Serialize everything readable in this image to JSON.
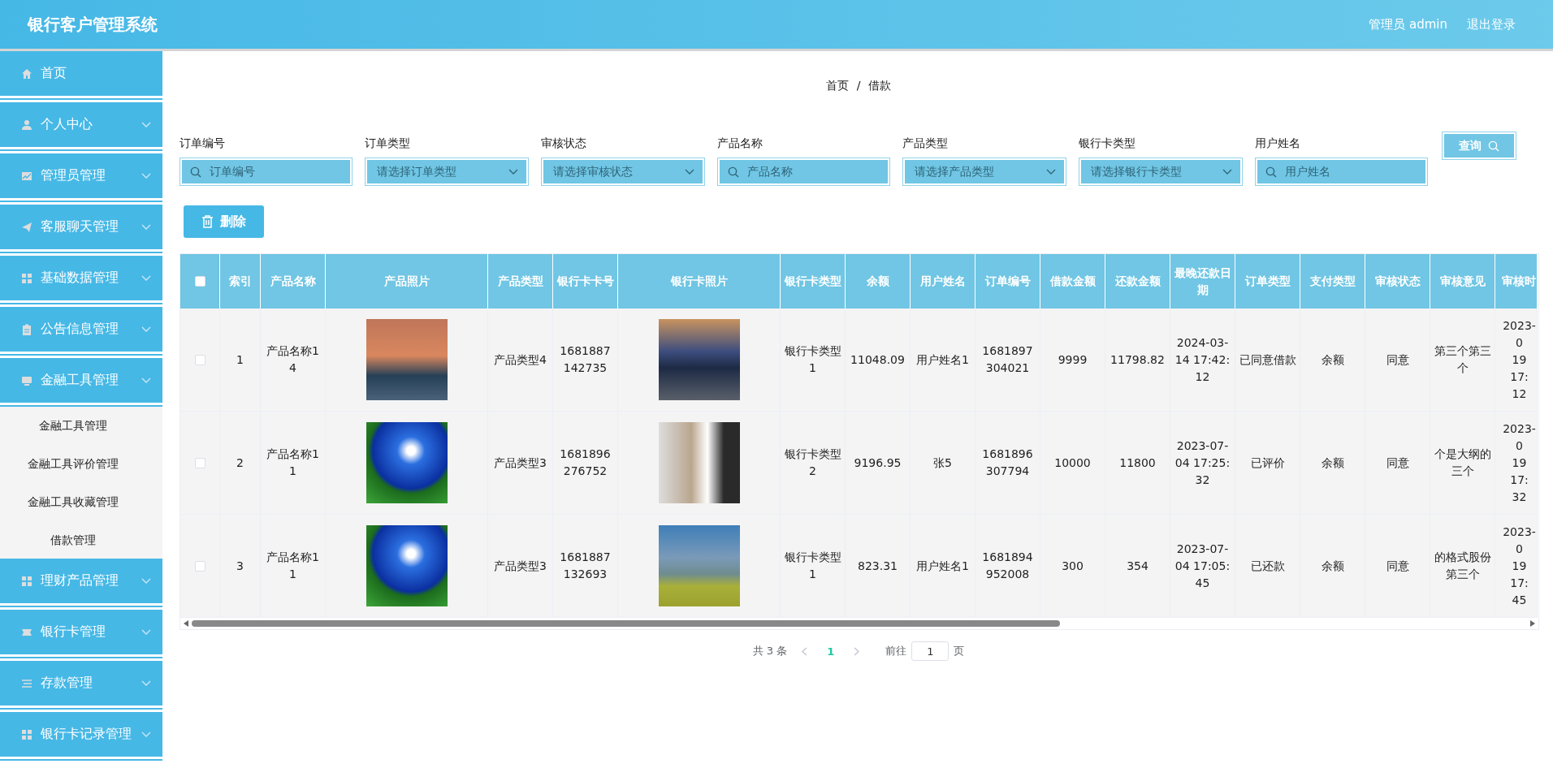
{
  "header": {
    "title": "银行客户管理系统",
    "user": "管理员 admin",
    "logout": "退出登录"
  },
  "sidebar": {
    "items": [
      {
        "label": "首页",
        "kind": "link"
      },
      {
        "label": "个人中心",
        "kind": "submenu"
      },
      {
        "label": "管理员管理",
        "kind": "submenu"
      },
      {
        "label": "客服聊天管理",
        "kind": "submenu"
      },
      {
        "label": "基础数据管理",
        "kind": "submenu"
      },
      {
        "label": "公告信息管理",
        "kind": "submenu"
      },
      {
        "label": "金融工具管理",
        "kind": "submenu",
        "expanded": true,
        "children": [
          {
            "label": "金融工具管理"
          },
          {
            "label": "金融工具评价管理"
          },
          {
            "label": "金融工具收藏管理"
          },
          {
            "label": "借款管理"
          }
        ]
      },
      {
        "label": "理财产品管理",
        "kind": "submenu"
      },
      {
        "label": "银行卡管理",
        "kind": "submenu"
      },
      {
        "label": "存款管理",
        "kind": "submenu"
      },
      {
        "label": "银行卡记录管理",
        "kind": "submenu"
      }
    ]
  },
  "breadcrumb": {
    "items": [
      "首页",
      "借款"
    ],
    "separator": "/"
  },
  "search": {
    "fields": [
      {
        "label": "订单编号",
        "kind": "text",
        "placeholder": "订单编号"
      },
      {
        "label": "订单类型",
        "kind": "select",
        "placeholder": "请选择订单类型"
      },
      {
        "label": "审核状态",
        "kind": "select",
        "placeholder": "请选择审核状态"
      },
      {
        "label": "产品名称",
        "kind": "text",
        "placeholder": "产品名称"
      },
      {
        "label": "产品类型",
        "kind": "select",
        "placeholder": "请选择产品类型"
      },
      {
        "label": "银行卡类型",
        "kind": "select",
        "placeholder": "请选择银行卡类型"
      },
      {
        "label": "用户姓名",
        "kind": "text",
        "placeholder": "用户姓名"
      }
    ],
    "button": "查询"
  },
  "actions": {
    "delete": "删除"
  },
  "table": {
    "select_all_checked": false,
    "columns": [
      {
        "kind": "check"
      },
      {
        "label": "索引",
        "kind": "index"
      },
      {
        "label": "产品名称",
        "kind": "text"
      },
      {
        "label": "产品照片",
        "kind": "image"
      },
      {
        "label": "产品类型",
        "kind": "text"
      },
      {
        "label": "银行卡卡号",
        "kind": "text"
      },
      {
        "label": "银行卡照片",
        "kind": "image"
      },
      {
        "label": "银行卡类型",
        "kind": "text"
      },
      {
        "label": "余额",
        "kind": "text"
      },
      {
        "label": "用户姓名",
        "kind": "text"
      },
      {
        "label": "订单编号",
        "kind": "text"
      },
      {
        "label": "借款金额",
        "kind": "text"
      },
      {
        "label": "还款金额",
        "kind": "text"
      },
      {
        "label": "最晚还款日期",
        "kind": "text"
      },
      {
        "label": "订单类型",
        "kind": "text"
      },
      {
        "label": "支付类型",
        "kind": "text"
      },
      {
        "label": "审核状态",
        "kind": "text"
      },
      {
        "label": "审核意见",
        "kind": "text"
      },
      {
        "label": "审核时",
        "kind": "clipped"
      }
    ],
    "rows": [
      {
        "checked": false,
        "cells": [
          "",
          "1",
          "产品名称14",
          "",
          "产品类型4",
          "1681887142735",
          "",
          "银行卡类型1",
          "11048.09",
          "用户姓名1",
          "1681897304021",
          "9999",
          "11798.82",
          "2024-03-14 17:42:12",
          "已同意借款",
          "余额",
          "同意",
          "第三个第三个",
          "2023-0\n19 17:\n12"
        ]
      },
      {
        "checked": false,
        "cells": [
          "",
          "2",
          "产品名称11",
          "",
          "产品类型3",
          "1681896276752",
          "",
          "银行卡类型2",
          "9196.95",
          "张5",
          "1681896307794",
          "10000",
          "11800",
          "2023-07-04 17:25:32",
          "已评价",
          "余额",
          "同意",
          "个是大纲的三个",
          "2023-0\n19 17:\n32"
        ]
      },
      {
        "checked": false,
        "cells": [
          "",
          "3",
          "产品名称11",
          "",
          "产品类型3",
          "1681887132693",
          "",
          "银行卡类型1",
          "823.31",
          "用户姓名1",
          "1681894952008",
          "300",
          "354",
          "2023-07-04 17:05:45",
          "已还款",
          "余额",
          "同意",
          "的格式股份第三个",
          "2023-0\n19 17:\n45"
        ]
      }
    ]
  },
  "pagination": {
    "total": "共 3 条",
    "pages": [
      {
        "label": "1",
        "selected": true
      }
    ],
    "goto_label": "前往",
    "goto_value": "1",
    "page_unit": "页"
  }
}
